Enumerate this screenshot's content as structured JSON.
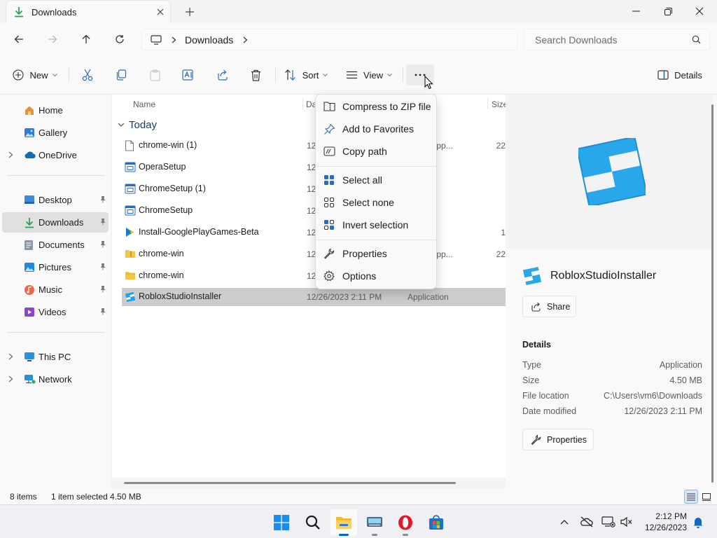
{
  "window": {
    "tab_title": "Downloads"
  },
  "address": {
    "crumb": "Downloads",
    "search_placeholder": "Search Downloads"
  },
  "toolbar": {
    "new_label": "New",
    "sort_label": "Sort",
    "view_label": "View",
    "details_label": "Details"
  },
  "sidebar": {
    "items": [
      {
        "label": "Home",
        "icon": "home-icon"
      },
      {
        "label": "Gallery",
        "icon": "gallery-icon"
      },
      {
        "label": "OneDrive",
        "icon": "onedrive-icon"
      },
      {
        "label": "Desktop",
        "icon": "desktop-icon"
      },
      {
        "label": "Downloads",
        "icon": "downloads-icon"
      },
      {
        "label": "Documents",
        "icon": "documents-icon"
      },
      {
        "label": "Pictures",
        "icon": "pictures-icon"
      },
      {
        "label": "Music",
        "icon": "music-icon"
      },
      {
        "label": "Videos",
        "icon": "videos-icon"
      },
      {
        "label": "This PC",
        "icon": "this-pc-icon"
      },
      {
        "label": "Network",
        "icon": "network-icon"
      }
    ]
  },
  "filelist": {
    "columns": [
      "Name",
      "Da",
      "Size"
    ],
    "group": "Today",
    "rows": [
      {
        "name": "chrome-win (1)",
        "date": "12",
        "type": "ssed (zipp...",
        "size": "22",
        "icon": "zip-file-icon"
      },
      {
        "name": "OperaSetup",
        "date": "12",
        "type": "ation",
        "size": "",
        "icon": "application-icon"
      },
      {
        "name": "ChromeSetup (1)",
        "date": "12",
        "type": "ation",
        "size": "",
        "icon": "application-icon"
      },
      {
        "name": "ChromeSetup",
        "date": "12",
        "type": "ation",
        "size": "",
        "icon": "application-icon"
      },
      {
        "name": "Install-GooglePlayGames-Beta",
        "date": "12",
        "type": "ation",
        "size": "1",
        "icon": "google-play-games-icon"
      },
      {
        "name": "chrome-win",
        "date": "12",
        "type": "ssed (zipp...",
        "size": "22",
        "icon": "zip-folder-icon"
      },
      {
        "name": "chrome-win",
        "date": "12",
        "type": "er",
        "size": "",
        "icon": "folder-icon"
      },
      {
        "name": "RobloxStudioInstaller",
        "date": "12/26/2023 2:11 PM",
        "type": "Application",
        "size": "",
        "icon": "roblox-studio-icon"
      }
    ]
  },
  "context_menu": {
    "items": [
      {
        "label": "Compress to ZIP file",
        "icon": "zip-icon"
      },
      {
        "label": "Add to Favorites",
        "icon": "pin-icon"
      },
      {
        "label": "Copy path",
        "icon": "copy-path-icon"
      },
      {
        "label": "Select all",
        "icon": "select-all-icon"
      },
      {
        "label": "Select none",
        "icon": "select-none-icon"
      },
      {
        "label": "Invert selection",
        "icon": "invert-selection-icon"
      },
      {
        "label": "Properties",
        "icon": "properties-icon"
      },
      {
        "label": "Options",
        "icon": "options-icon"
      }
    ]
  },
  "details": {
    "title": "RobloxStudioInstaller",
    "share_label": "Share",
    "section_label": "Details",
    "properties": [
      {
        "key": "Type",
        "value": "Application"
      },
      {
        "key": "Size",
        "value": "4.50 MB"
      },
      {
        "key": "File location",
        "value": "C:\\Users\\vm6\\Downloads"
      },
      {
        "key": "Date modified",
        "value": "12/26/2023 2:11 PM"
      }
    ],
    "properties_button": "Properties"
  },
  "status": {
    "items_count": "8 items",
    "selection": "1 item selected  4.50 MB"
  },
  "taskbar": {
    "time": "2:12 PM",
    "date": "12/26/2023"
  },
  "colors": {
    "accent": "#0067c0",
    "roblox_blue": "#1fa3e8",
    "selection_gray": "#cccccc"
  }
}
